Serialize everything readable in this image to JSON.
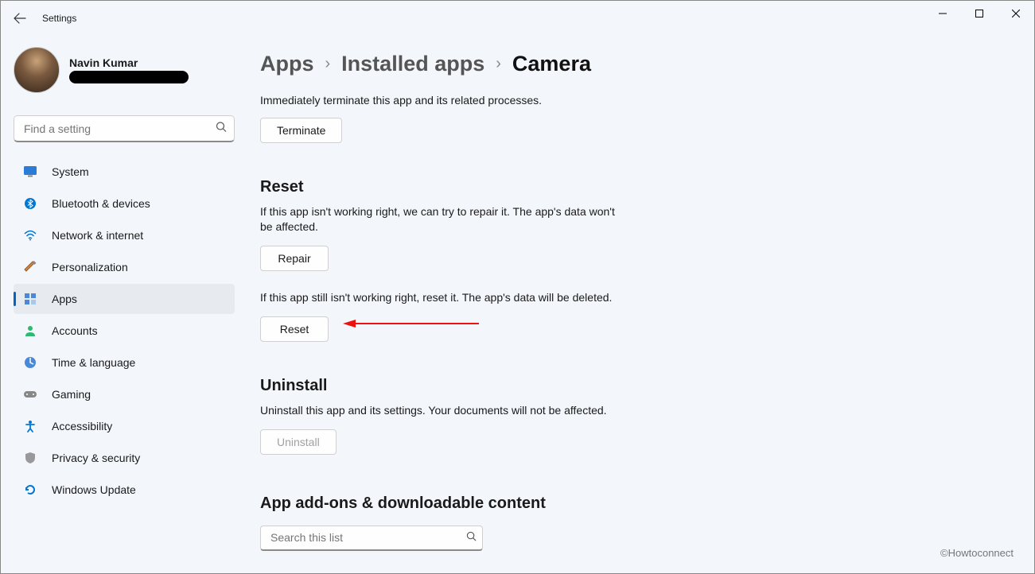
{
  "window": {
    "title": "Settings"
  },
  "user": {
    "name": "Navin Kumar"
  },
  "search": {
    "placeholder": "Find a setting"
  },
  "nav": [
    {
      "icon": "system",
      "label": "System"
    },
    {
      "icon": "bluetooth",
      "label": "Bluetooth & devices"
    },
    {
      "icon": "wifi",
      "label": "Network & internet"
    },
    {
      "icon": "brush",
      "label": "Personalization"
    },
    {
      "icon": "apps",
      "label": "Apps"
    },
    {
      "icon": "accounts",
      "label": "Accounts"
    },
    {
      "icon": "time",
      "label": "Time & language"
    },
    {
      "icon": "gaming",
      "label": "Gaming"
    },
    {
      "icon": "accessibility",
      "label": "Accessibility"
    },
    {
      "icon": "privacy",
      "label": "Privacy & security"
    },
    {
      "icon": "update",
      "label": "Windows Update"
    }
  ],
  "crumb": {
    "a": "Apps",
    "b": "Installed apps",
    "c": "Camera"
  },
  "terminate": {
    "desc": "Immediately terminate this app and its related processes.",
    "btn": "Terminate"
  },
  "reset": {
    "heading": "Reset",
    "repair_desc": "If this app isn't working right, we can try to repair it. The app's data won't be affected.",
    "repair_btn": "Repair",
    "reset_desc": "If this app still isn't working right, reset it. The app's data will be deleted.",
    "reset_btn": "Reset"
  },
  "uninstall": {
    "heading": "Uninstall",
    "desc": "Uninstall this app and its settings. Your documents will not be affected.",
    "btn": "Uninstall"
  },
  "addons": {
    "heading": "App add-ons & downloadable content",
    "search_placeholder": "Search this list"
  },
  "watermark": "©Howtoconnect"
}
